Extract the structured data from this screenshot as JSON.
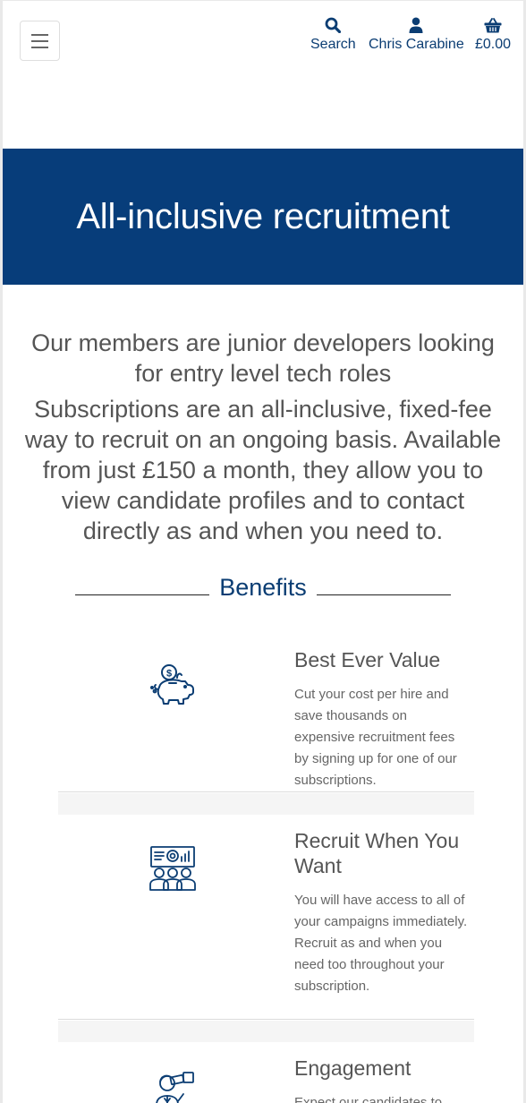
{
  "header": {
    "menu_icon": "hamburger-icon",
    "nav": [
      {
        "label": "Search",
        "icon": "search-icon"
      },
      {
        "label": "Chris Carabine",
        "icon": "user-icon"
      },
      {
        "label": "£0.00",
        "icon": "basket-icon"
      }
    ]
  },
  "hero": {
    "title": "All-inclusive recruitment",
    "background": "#073d7a"
  },
  "intro": {
    "line1": "Our members are junior developers looking for entry level tech roles",
    "line2": "Subscriptions are an all-inclusive, fixed-fee way to recruit on an ongoing basis. Available from just £150 a month, they allow you to view candidate profiles and to contact directly as and when you need to."
  },
  "benefits": {
    "heading": "Benefits",
    "items": [
      {
        "icon": "piggy-bank-icon",
        "title": "Best Ever Value",
        "text": "Cut your cost per hire and save thousands on expensive recruitment fees by signing up for one of our subscriptions."
      },
      {
        "icon": "team-presentation-icon",
        "title": "Recruit When You Want",
        "text": "You will have access to all of your campaigns immediately. Recruit as and when you need too throughout your subscription."
      },
      {
        "icon": "telescope-person-icon",
        "title": "Engagement",
        "text": "Expect our candidates to"
      }
    ]
  },
  "colors": {
    "brand": "#073d7a",
    "accent_text": "#0b3d73"
  }
}
